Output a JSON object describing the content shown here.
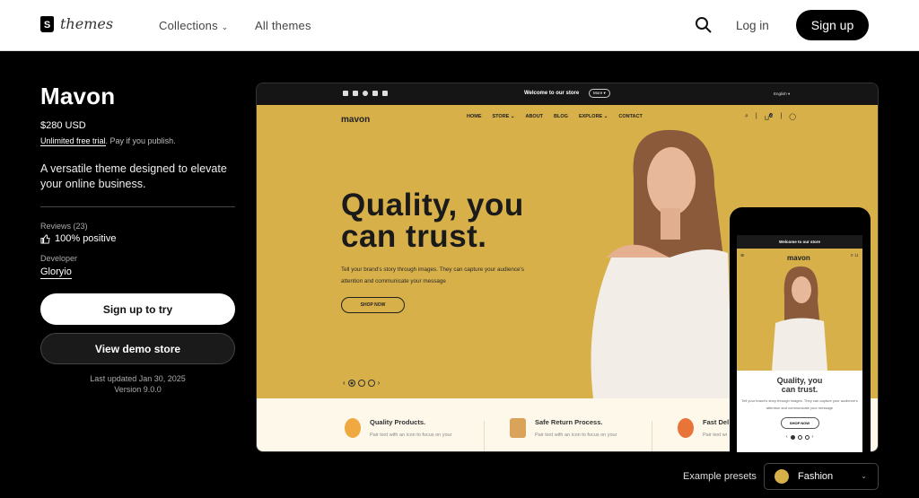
{
  "header": {
    "logo_text": "themes",
    "nav": [
      {
        "label": "Collections"
      },
      {
        "label": "All themes"
      }
    ],
    "login_label": "Log in",
    "signup_label": "Sign up"
  },
  "theme": {
    "name": "Mavon",
    "price": "$280 USD",
    "trial_link": "Unlimited free trial",
    "trial_suffix": ". Pay if you publish.",
    "description": "A versatile theme designed to elevate your online business.",
    "reviews_label": "Reviews (23)",
    "reviews_value": "100% positive",
    "developer_label": "Developer",
    "developer_name": "Gloryio",
    "primary_button": "Sign up to try",
    "secondary_button": "View demo store",
    "last_updated": "Last updated Jan 30, 2025",
    "version": "Version 9.0.0"
  },
  "preview": {
    "announcement": "Welcome to our store",
    "more_label": "More ▾",
    "language": "English ▾",
    "brand": "mavon",
    "menu": [
      "HOME",
      "STORE ⌄",
      "ABOUT",
      "BLOG",
      "EXPLORE ⌄",
      "CONTACT"
    ],
    "headline": "Quality, you can trust.",
    "subtext": "Tell your brand's story through images. They can capture your audience's attention and communicate your message",
    "cta": "SHOP NOW",
    "cart_count": "0",
    "slides": {
      "current": 1,
      "total": 3
    },
    "features": [
      {
        "title": "Quality Products.",
        "text": "Pair text with an icon to focus on your"
      },
      {
        "title": "Safe Return Process.",
        "text": "Pair text with an icon to focus on your"
      },
      {
        "title": "Fast Del",
        "text": "Pair text wi"
      }
    ],
    "accent_color": "#d8b04a"
  },
  "presets": {
    "label": "Example presets",
    "selected": "Fashion",
    "swatch_color": "#d8b04a"
  }
}
